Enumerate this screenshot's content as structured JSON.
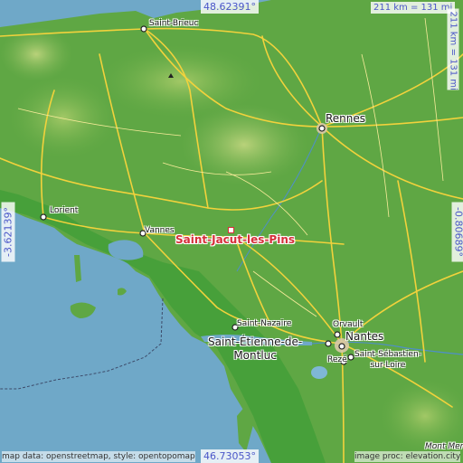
{
  "place": {
    "name": "Saint-Jacut-les-Pins"
  },
  "coords": {
    "top": "48.62391°",
    "bottom": "46.73053°",
    "left": "-3.62139°",
    "right": "-0.80689°"
  },
  "scale": {
    "horizontal": "211 km = 131 mi",
    "vertical": "211 km = 131 mi"
  },
  "cities": {
    "saint_brieuc": "Saint-Brieuc",
    "rennes": "Rennes",
    "lorient": "Lorient",
    "vannes": "Vannes",
    "saint_nazaire": "Saint-Nazaire",
    "saint_etienne_1": "Saint-Étienne-de-",
    "saint_etienne_2": "Montluc",
    "orvault": "Orvault",
    "nantes": "Nantes",
    "saint_sebastien_1": "Saint-Sébastien-",
    "saint_sebastien_2": "sur-Loire",
    "reze": "Rezé",
    "mont_merc": "Mont Merc"
  },
  "credits": {
    "left": "map data: openstreetmap, style: opentopomap",
    "right": "image proc: elevation.city"
  },
  "colors": {
    "sea": "#6fa8c8",
    "land_low": "#3f9a3a",
    "land_mid": "#6db24c",
    "land_high": "#a8c96a",
    "roads": "#f2d23c",
    "highlight": "#d62f3a",
    "coord_text": "#4a56c8"
  }
}
